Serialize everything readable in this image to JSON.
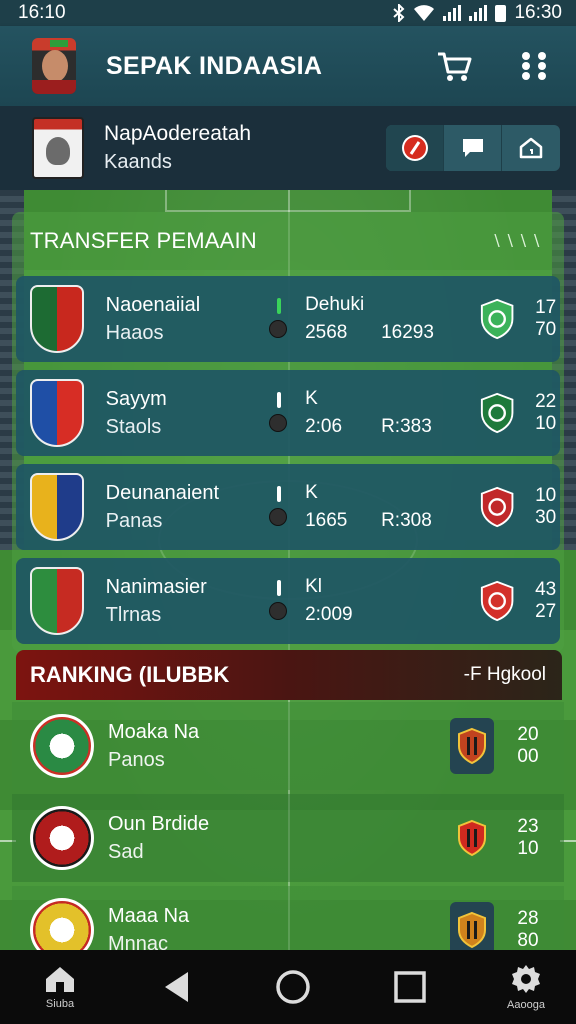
{
  "status_bar": {
    "time_left": "16:10",
    "time_right": "16:30"
  },
  "app_bar": {
    "title": "SEPAK INDAASIA",
    "cart_icon": "cart-icon",
    "menu_icon": "grid-dots-icon"
  },
  "user": {
    "name": "NapAodereatah",
    "subtitle": "Kaands",
    "actions": [
      {
        "icon": "pin-icon",
        "color": "#d62c1f"
      },
      {
        "icon": "chat-icon"
      },
      {
        "icon": "home-icon"
      }
    ]
  },
  "transfer": {
    "title": "TRANSFER PEMAAIN",
    "more": "\\\\\\\\",
    "rows": [
      {
        "name": "Naoenaiial",
        "sub": "Haaos",
        "label": "Dehuki",
        "stat1": "2568",
        "stat2": "16293",
        "n1": "17",
        "n2": "70",
        "badge_colors": [
          "#1d6b33",
          "#c8281e"
        ],
        "shield_color": "#3bb25a",
        "pin_color": "#3ad35a"
      },
      {
        "name": "Sayym",
        "sub": "Staols",
        "label": "K",
        "stat1": "2:06",
        "stat2": "R:383",
        "n1": "22",
        "n2": "10",
        "badge_colors": [
          "#1f4fa6",
          "#d72d25"
        ],
        "shield_color": "#1e7a3b",
        "pin_color": "#ffffff"
      },
      {
        "name": "Deunanaient",
        "sub": "Panas",
        "label": "K",
        "stat1": "1665",
        "stat2": "R:308",
        "n1": "10",
        "n2": "30",
        "badge_colors": [
          "#e8b21c",
          "#1f3c8a"
        ],
        "shield_color": "#c1282a",
        "pin_color": "#ffffff"
      },
      {
        "name": "Nanimasier",
        "sub": "Tlrnas",
        "label": "Kl",
        "stat1": "2:009",
        "stat2": "",
        "n1": "43",
        "n2": "27",
        "badge_colors": [
          "#2d8d3e",
          "#c62b22"
        ],
        "shield_color": "#d3302a",
        "pin_color": "#ffffff"
      }
    ]
  },
  "ranking": {
    "title": "RANKING (ILUBBK",
    "filter": "-F Hgkool",
    "rows": [
      {
        "name": "Moaka Na",
        "sub": "Panos",
        "n1": "20",
        "n2": "00",
        "badge_colors": [
          "#2a8a44",
          "#c93025"
        ],
        "icon_color": "#c1431f",
        "boxed": true
      },
      {
        "name": "Oun Brdide",
        "sub": "Sad",
        "n1": "23",
        "n2": "10",
        "badge_colors": [
          "#b01c1c",
          "#1a1a1a"
        ],
        "icon_color": "#d02a1f",
        "boxed": false
      },
      {
        "name": "Maaa Na",
        "sub": "Mnnac",
        "n1": "28",
        "n2": "80",
        "badge_colors": [
          "#e3c12a",
          "#c52a24"
        ],
        "icon_color": "#d0821c",
        "boxed": true
      }
    ]
  },
  "nav": {
    "home_label": "Siuba",
    "settings_label": "Aaooga",
    "home_icon": "home-icon",
    "back_icon": "back-triangle-icon",
    "circle_icon": "home-circle-icon",
    "square_icon": "recents-square-icon",
    "settings_icon": "gear-icon"
  }
}
